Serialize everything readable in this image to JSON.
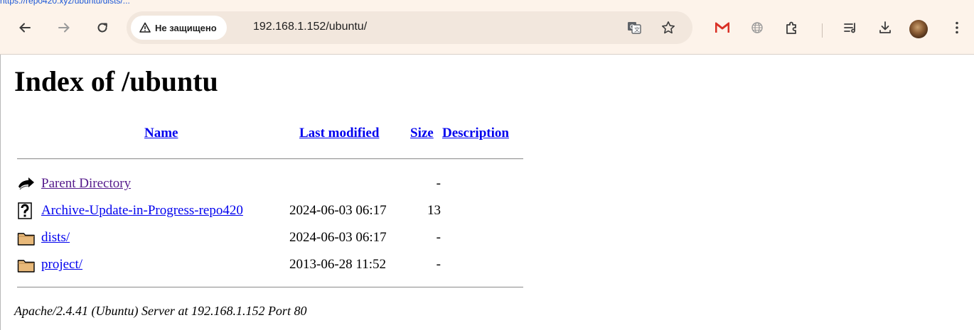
{
  "browser": {
    "top_link_text": "https://repo420.xyz/ubuntu/dists/...",
    "security_chip": "Не защищено",
    "url": "192.168.1.152/ubuntu/",
    "accent_color": "#fdf3ea",
    "icons": {
      "back": "arrow-left-icon",
      "forward": "arrow-right-icon",
      "reload": "reload-icon",
      "warning": "warning-triangle-icon",
      "translate": "translate-icon",
      "bookmark": "star-icon",
      "gmail": "gmail-icon",
      "globe": "globe-icon",
      "extensions": "puzzle-icon",
      "reading_list": "reading-list-icon",
      "download": "download-icon",
      "profile": "avatar",
      "menu": "kebab-menu-icon"
    }
  },
  "page": {
    "title": "Index of /ubuntu",
    "columns": {
      "name": "Name",
      "last_modified": "Last modified",
      "size": "Size",
      "description": "Description"
    },
    "rows": [
      {
        "icon": "back-arrow-icon",
        "name": "Parent Directory",
        "date": "",
        "size": "-",
        "visited": true
      },
      {
        "icon": "unknown-file-icon",
        "name": "Archive-Update-in-Progress-repo420",
        "date": "2024-06-03 06:17",
        "size": "13",
        "visited": false
      },
      {
        "icon": "folder-icon",
        "name": "dists/",
        "date": "2024-06-03 06:17",
        "size": "-",
        "visited": false
      },
      {
        "icon": "folder-icon",
        "name": "project/",
        "date": "2013-06-28 11:52",
        "size": "-",
        "visited": false
      }
    ],
    "address": "Apache/2.4.41 (Ubuntu) Server at 192.168.1.152 Port 80"
  }
}
